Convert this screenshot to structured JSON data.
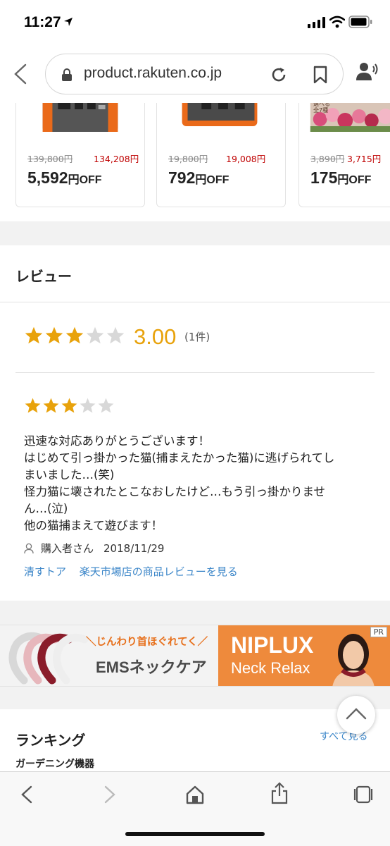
{
  "status_bar": {
    "time": "11:27"
  },
  "browser": {
    "url": "product.rakuten.co.jp"
  },
  "carousel": [
    {
      "old_price": "139,800円",
      "new_price": "134,208円",
      "discount_num": "5,592",
      "discount_unit": "円OFF"
    },
    {
      "old_price": "19,800円",
      "new_price": "19,008円",
      "discount_num": "792",
      "discount_unit": "円OFF"
    },
    {
      "old_price": "3,890円",
      "new_price": "3,715円",
      "discount_num": "175",
      "discount_unit": "円OFF",
      "image_label": "選べる全7種"
    }
  ],
  "reviews": {
    "title": "レビュー",
    "average": "3.00",
    "average_stars": 3,
    "count": "(1件)",
    "item": {
      "stars": 3,
      "lines": [
        "迅速な対応ありがとうございます！",
        "はじめて引っ掛かった猫(捕まえたかった猫)に逃げられてし",
        "まいました…(笑)",
        "怪力猫に壊されたとこなおしたけど…もう引っ掛かりませ",
        "ん…(泣)",
        "他の猫捕まえて遊びます！"
      ],
      "reviewer": "購入者さん",
      "date": "2018/11/29"
    },
    "links": [
      "清すトア",
      "楽天市場店の商品レビューを見る"
    ]
  },
  "ad": {
    "tagline": "＼じんわり首ほぐれてく／",
    "product": "EMSネックケア",
    "brand": "NIPLUX",
    "sub": "Neck Relax",
    "badge": "PR"
  },
  "ranking": {
    "title": "ランキング",
    "see_all": "すべて見る",
    "category": "ガーデニング機器"
  },
  "colors": {
    "star": "#e8a20b",
    "star_empty": "#d8d8d8",
    "link": "#3a85c8",
    "price_red": "#bf0000",
    "ad_orange": "#ee8a3c"
  },
  "icons": [
    "location-arrow-icon",
    "signal-icon",
    "wifi-icon",
    "battery-icon",
    "back-chevron-icon",
    "lock-icon",
    "reload-icon",
    "bookmark-icon",
    "listen-person-icon",
    "user-icon",
    "chevron-up-icon",
    "home-icon",
    "share-icon",
    "tabs-icon",
    "forward-chevron-icon"
  ]
}
